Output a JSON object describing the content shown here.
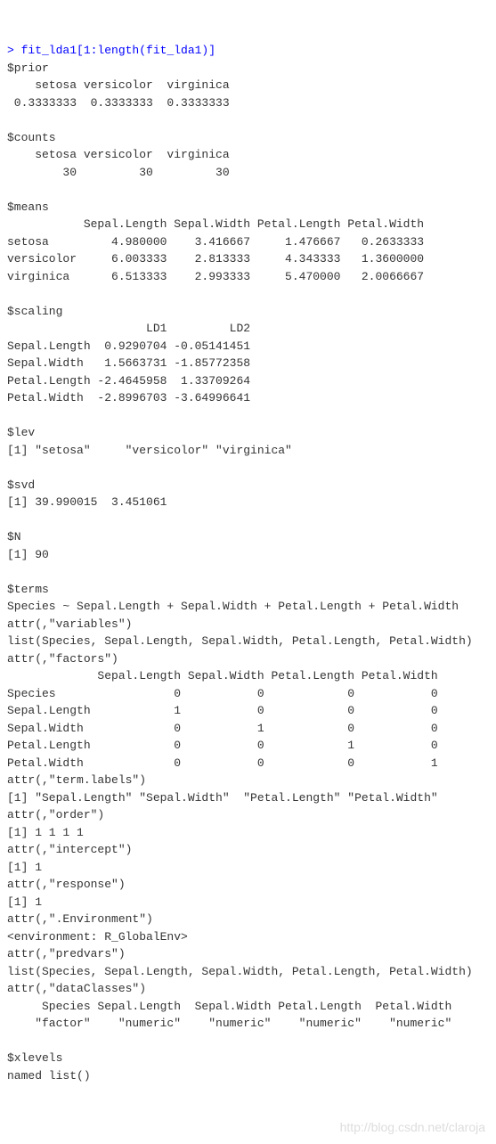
{
  "cmd": "> fit_lda1[1:length(fit_lda1)]",
  "prior": {
    "header": "$prior",
    "cols": "    setosa versicolor  virginica ",
    "vals": " 0.3333333  0.3333333  0.3333333 "
  },
  "counts": {
    "header": "$counts",
    "cols": "    setosa versicolor  virginica ",
    "vals": "        30         30         30 "
  },
  "means": {
    "header": "$means",
    "cols": "           Sepal.Length Sepal.Width Petal.Length Petal.Width",
    "r1": "setosa         4.980000    3.416667     1.476667   0.2633333",
    "r2": "versicolor     6.003333    2.813333     4.343333   1.3600000",
    "r3": "virginica      6.513333    2.993333     5.470000   2.0066667"
  },
  "scaling": {
    "header": "$scaling",
    "cols": "                    LD1         LD2",
    "r1": "Sepal.Length  0.9290704 -0.05141451",
    "r2": "Sepal.Width   1.5663731 -1.85772358",
    "r3": "Petal.Length -2.4645958  1.33709264",
    "r4": "Petal.Width  -2.8996703 -3.64996641"
  },
  "lev": {
    "header": "$lev",
    "vals": "[1] \"setosa\"     \"versicolor\" \"virginica\" "
  },
  "svd": {
    "header": "$svd",
    "vals": "[1] 39.990015  3.451061"
  },
  "n": {
    "header": "$N",
    "vals": "[1] 90"
  },
  "terms": {
    "header": "$terms",
    "formula": "Species ~ Sepal.Length + Sepal.Width + Petal.Length + Petal.Width",
    "attr_vars": "attr(,\"variables\")",
    "list_vars": "list(Species, Sepal.Length, Sepal.Width, Petal.Length, Petal.Width)",
    "attr_factors": "attr(,\"factors\")",
    "fcols": "             Sepal.Length Sepal.Width Petal.Length Petal.Width",
    "f1": "Species                 0           0            0           0",
    "f2": "Sepal.Length            1           0            0           0",
    "f3": "Sepal.Width             0           1            0           0",
    "f4": "Petal.Length            0           0            1           0",
    "f5": "Petal.Width             0           0            0           1",
    "attr_termlabels": "attr(,\"term.labels\")",
    "termlabels": "[1] \"Sepal.Length\" \"Sepal.Width\"  \"Petal.Length\" \"Petal.Width\" ",
    "attr_order": "attr(,\"order\")",
    "order": "[1] 1 1 1 1",
    "attr_intercept": "attr(,\"intercept\")",
    "intercept": "[1] 1",
    "attr_response": "attr(,\"response\")",
    "response": "[1] 1",
    "attr_env": "attr(,\".Environment\")",
    "env": "<environment: R_GlobalEnv>",
    "attr_predvars": "attr(,\"predvars\")",
    "predvars": "list(Species, Sepal.Length, Sepal.Width, Petal.Length, Petal.Width)",
    "attr_dataclasses": "attr(,\"dataClasses\")",
    "dc_cols": "     Species Sepal.Length  Sepal.Width Petal.Length  Petal.Width ",
    "dc_vals": "    \"factor\"    \"numeric\"    \"numeric\"    \"numeric\"    \"numeric\" "
  },
  "xlevels": {
    "header": "$xlevels",
    "vals": "named list()"
  },
  "watermark": "http://blog.csdn.net/claroja"
}
